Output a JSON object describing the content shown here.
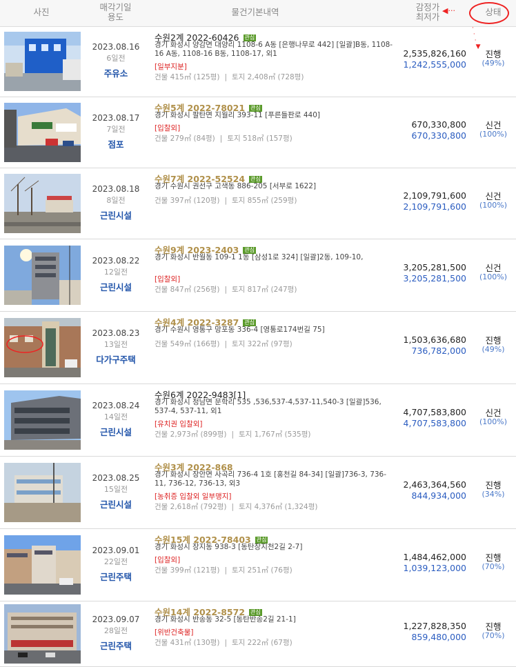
{
  "header": {
    "photo": "사진",
    "date_line1": "매각기일",
    "date_line2": "용도",
    "info": "물건기본내역",
    "price_line1": "감정가",
    "price_line2": "최저가",
    "status": "상태"
  },
  "badge_label": "관심",
  "listings": [
    {
      "date": "2023.08.16",
      "days": "6일전",
      "use": "주유소",
      "case": "수원2계 2022-60426",
      "case_style": "black",
      "badge": true,
      "address": "경기 화성시 양감면 대양리 1108-6 A동 [은행나무로 442] [일괄]B동, 1108-16 A동, 1108-16 B동, 1108-17, 외1",
      "notes": "[일부지분]",
      "building": "건물 415㎡ (125평)",
      "land": "토지 2,408㎡ (728평)",
      "appraisal": "2,535,826,160",
      "minimum": "1,242,555,000",
      "status": "진행",
      "percent": "(49%)"
    },
    {
      "date": "2023.08.17",
      "days": "7일전",
      "use": "점포",
      "case": "수원5계 2022-78021",
      "case_style": "gold",
      "badge": true,
      "address": "경기 화성시 팔탄면 지월리 393-11 [푸른들판로 440]",
      "notes": "[입찰외]",
      "building": "건물 279㎡ (84평)",
      "land": "토지 518㎡ (157평)",
      "appraisal": "670,330,800",
      "minimum": "670,330,800",
      "status": "신건",
      "percent": "(100%)"
    },
    {
      "date": "2023.08.18",
      "days": "8일전",
      "use": "근린시설",
      "case": "수원7계 2022-52524",
      "case_style": "gold",
      "badge": true,
      "address": "경기 수원시 권선구 고색동 886-205 [서부로 1622]",
      "notes": "",
      "building": "건물 397㎡ (120평)",
      "land": "토지 855㎡ (259평)",
      "appraisal": "2,109,791,600",
      "minimum": "2,109,791,600",
      "status": "신건",
      "percent": "(100%)"
    },
    {
      "date": "2023.08.22",
      "days": "12일전",
      "use": "근린시설",
      "case": "수원9계 2023-2403",
      "case_style": "gold",
      "badge": true,
      "address": "경기 화성시 반월동 109-1 1동 [삼성1로 324] [일괄]2동, 109-10,",
      "notes": "[입찰외]",
      "building": "건물 847㎡ (256평)",
      "land": "토지 817㎡ (247평)",
      "appraisal": "3,205,281,500",
      "minimum": "3,205,281,500",
      "status": "신건",
      "percent": "(100%)"
    },
    {
      "date": "2023.08.23",
      "days": "13일전",
      "use": "다가구주택",
      "case": "수원4계 2022-3287",
      "case_style": "gold",
      "badge": true,
      "address": "경기 수원시 영통구 망포동 336-4 [영통로174번길 75]",
      "notes": "",
      "building": "건물 549㎡ (166평)",
      "land": "토지 322㎡ (97평)",
      "appraisal": "1,503,636,680",
      "minimum": "736,782,000",
      "status": "진행",
      "percent": "(49%)"
    },
    {
      "date": "2023.08.24",
      "days": "14일전",
      "use": "근린시설",
      "case": "수원6계 2022-9483[1]",
      "case_style": "black",
      "badge": false,
      "address": "경기 화성시 정남면 문학리 535 ,536,537-4,537-11,540-3 [일괄]536, 537-4, 537-11, 외1",
      "notes": "[유치권   입찰외]",
      "building": "건물 2,973㎡ (899평)",
      "land": "토지 1,767㎡ (535평)",
      "appraisal": "4,707,583,800",
      "minimum": "4,707,583,800",
      "status": "신건",
      "percent": "(100%)"
    },
    {
      "date": "2023.08.25",
      "days": "15일전",
      "use": "근린시설",
      "case": "수원3계 2022-868",
      "case_style": "gold",
      "badge": false,
      "address": "경기 화성시 장안면 사곡리 736-4 1호 [홍천길 84-34] [일괄]736-3, 736-11, 736-12, 736-13, 외3",
      "notes": "[농취증   입찰외   일부맹지]",
      "building": "건물 2,618㎡ (792평)",
      "land": "토지 4,376㎡ (1,324평)",
      "appraisal": "2,463,364,560",
      "minimum": "844,934,000",
      "status": "진행",
      "percent": "(34%)"
    },
    {
      "date": "2023.09.01",
      "days": "22일전",
      "use": "근린주택",
      "case": "수원15계 2022-78403",
      "case_style": "gold",
      "badge": true,
      "address": "경기 화성시 장지동 938-3 [동탄장지천2길 2-7]",
      "notes": "[입찰외]",
      "building": "건물 399㎡ (121평)",
      "land": "토지 251㎡ (76평)",
      "appraisal": "1,484,462,000",
      "minimum": "1,039,123,000",
      "status": "진행",
      "percent": "(70%)"
    },
    {
      "date": "2023.09.07",
      "days": "28일전",
      "use": "근린주택",
      "case": "수원14계 2022-8572",
      "case_style": "gold",
      "badge": true,
      "address": "경기 화성시 반송동 32-5 [동탄반송2길 21-1]",
      "notes": "[위반건축물]",
      "building": "건물 431㎡ (130평)",
      "land": "토지 222㎡ (67평)",
      "appraisal": "1,227,828,350",
      "minimum": "859,480,000",
      "status": "진행",
      "percent": "(70%)"
    }
  ]
}
